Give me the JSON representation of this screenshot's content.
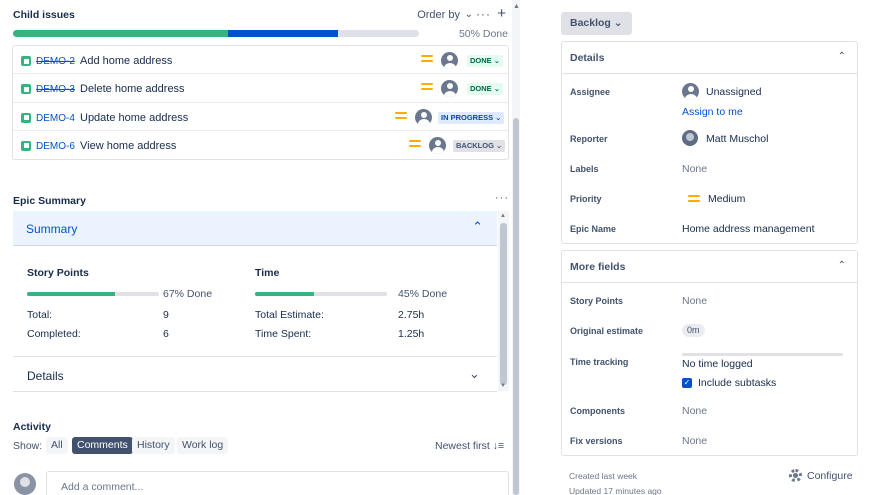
{
  "child_issues": {
    "title": "Child issues",
    "order_by": "Order by",
    "more": "···",
    "add": "+",
    "progress": {
      "done": 0.53,
      "in_progress": 0.27,
      "label": "50% Done"
    },
    "items": [
      {
        "key": "DEMO-2",
        "summary": "Add home address",
        "status": "DONE ⌄",
        "done": true
      },
      {
        "key": "DEMO-3",
        "summary": "Delete home address",
        "status": "DONE ⌄",
        "done": true
      },
      {
        "key": "DEMO-4",
        "summary": "Update home address",
        "status": "IN PROGRESS ⌄",
        "done": false
      },
      {
        "key": "DEMO-6",
        "summary": "View home address",
        "status": "BACKLOG ⌄",
        "done": false
      }
    ]
  },
  "epic_summary": {
    "title": "Epic Summary",
    "more": "···",
    "summary_label": "Summary",
    "story_points": {
      "heading": "Story Points",
      "progress": 0.67,
      "progress_label": "67% Done",
      "total_label": "Total:",
      "total_value": "9",
      "completed_label": "Completed:",
      "completed_value": "6"
    },
    "time": {
      "heading": "Time",
      "progress": 0.45,
      "progress_label": "45% Done",
      "estimate_label": "Total Estimate:",
      "estimate_value": "2.75h",
      "spent_label": "Time Spent:",
      "spent_value": "1.25h"
    },
    "details_label": "Details"
  },
  "activity": {
    "title": "Activity",
    "show_label": "Show:",
    "filters": [
      "All",
      "Comments",
      "History",
      "Work log"
    ],
    "active_filter": "Comments",
    "sort_label": "Newest first ↓≡",
    "comment_placeholder": "Add a comment..."
  },
  "sidebar": {
    "status_button": "Backlog ⌄",
    "details": {
      "title": "Details",
      "assignee_label": "Assignee",
      "assignee_value": "Unassigned",
      "assign_to_me": "Assign to me",
      "reporter_label": "Reporter",
      "reporter_value": "Matt Muschol",
      "labels_label": "Labels",
      "labels_value": "None",
      "priority_label": "Priority",
      "priority_value": "Medium",
      "epic_name_label": "Epic Name",
      "epic_name_value": "Home address management"
    },
    "more_fields": {
      "title": "More fields",
      "story_points_label": "Story Points",
      "story_points_value": "None",
      "original_estimate_label": "Original estimate",
      "original_estimate_value": "0m",
      "time_tracking_label": "Time tracking",
      "time_tracking_value": "No time logged",
      "include_subtasks": "Include subtasks",
      "components_label": "Components",
      "components_value": "None",
      "fix_versions_label": "Fix versions",
      "fix_versions_value": "None"
    },
    "created": "Created last week",
    "updated": "Updated 17 minutes ago",
    "configure": "Configure"
  },
  "colors": {
    "done_green": "#36b37e",
    "progress_blue": "#0052cc",
    "priority_orange": "#ffab00"
  }
}
